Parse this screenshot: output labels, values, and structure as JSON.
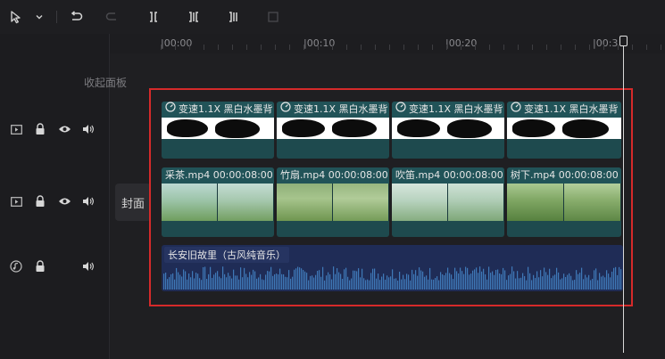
{
  "ruler": {
    "ticks": [
      "|00:00",
      "|00:10",
      "|00:20",
      "|00:3"
    ]
  },
  "panel": {
    "collapse_label": "收起面板",
    "cover_label": "封面"
  },
  "overlay_clips": [
    {
      "label": "变速1.1X  黑白水墨背"
    },
    {
      "label": "变速1.1X  黑白水墨背"
    },
    {
      "label": "变速1.1X  黑白水墨背"
    },
    {
      "label": "变速1.1X  黑白水墨背"
    }
  ],
  "video_clips": [
    {
      "label": "采茶.mp4  00:00:08:00"
    },
    {
      "label": "竹扇.mp4  00:00:08:00"
    },
    {
      "label": "吹笛.mp4  00:00:08:00"
    },
    {
      "label": "树下.mp4  00:00:08:00"
    }
  ],
  "audio_clip": {
    "label": "长安旧故里（古风纯音乐）"
  },
  "colors": {
    "highlight": "#d52a2a",
    "clip": "#1e4a4e",
    "audio": "#1f2c56",
    "waveform": "#3f79b8"
  },
  "icons": [
    "cursor-select-icon",
    "chevron-down-icon",
    "undo-icon",
    "redo-icon",
    "split-icon",
    "trim-left-icon",
    "trim-right-icon",
    "delete-icon",
    "video-track-icon",
    "lock-icon",
    "eye-icon",
    "volume-icon",
    "audio-track-icon"
  ]
}
